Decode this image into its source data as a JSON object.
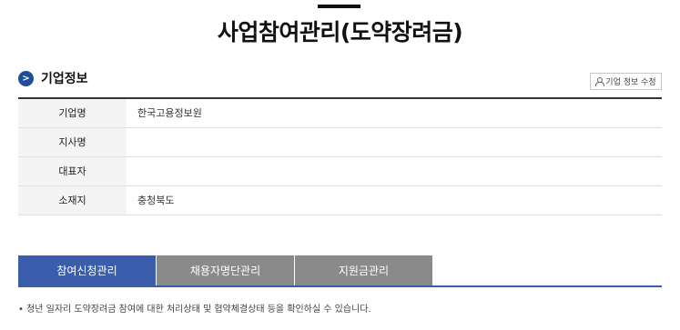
{
  "page": {
    "title": "사업참여관리(도약장려금)"
  },
  "section": {
    "bullet": ">",
    "title": "기업정보",
    "edit_label": "기업 정보 수정"
  },
  "company": {
    "rows": [
      {
        "label": "기업명",
        "value": "한국고용정보원"
      },
      {
        "label": "지사명",
        "value": ""
      },
      {
        "label": "대표자",
        "value": ""
      },
      {
        "label": "소재지",
        "value": "충청북도"
      }
    ]
  },
  "tabs": [
    {
      "label": "참여신청관리",
      "active": true
    },
    {
      "label": "채용자명단관리",
      "active": false
    },
    {
      "label": "지원금관리",
      "active": false
    }
  ],
  "notice": "• 청년 일자리 도약장려금 참여에 대한 처리상태 및 협약체결상태 등을 확인하실 수 있습니다.",
  "colors": {
    "accent": "#3a5eab",
    "tab_inactive": "#8a8a8a",
    "bullet": "#1f4e96"
  }
}
